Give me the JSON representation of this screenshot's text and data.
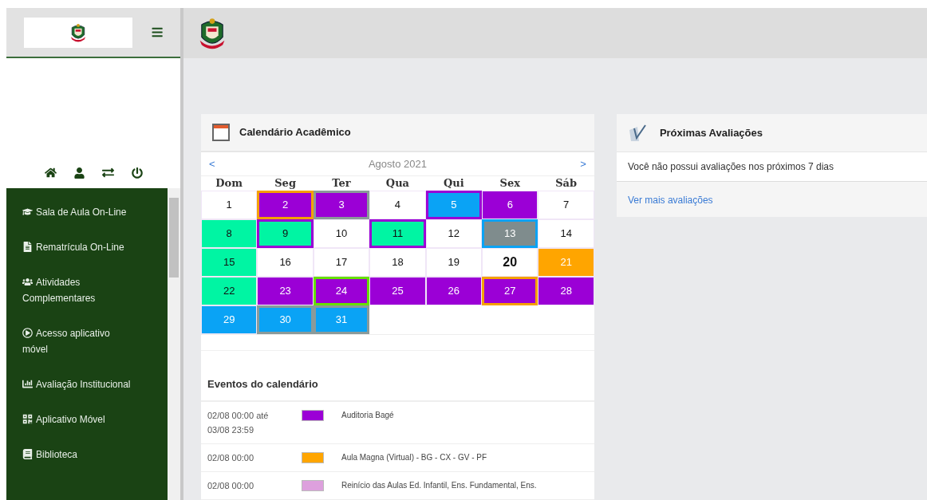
{
  "sidebar": {
    "menu": [
      {
        "label": "Sala de Aula On-Line"
      },
      {
        "label": "Rematrícula On-Line"
      },
      {
        "label": "Atividades Complementares"
      },
      {
        "label": "Acesso aplicativo móvel"
      },
      {
        "label": "Avaliação Institucional"
      },
      {
        "label": "Aplicativo Móvel"
      },
      {
        "label": "Biblioteca"
      }
    ]
  },
  "calendar": {
    "title": "Calendário Acadêmico",
    "prev": "<",
    "next": ">",
    "month": "Agosto 2021",
    "weekdays": [
      "Dom",
      "Seg",
      "Ter",
      "Qua",
      "Qui",
      "Sex",
      "Sáb"
    ],
    "days": [
      {
        "day": "1",
        "today": false
      },
      {
        "day": "2",
        "color": "#9b00d6",
        "ring": {
          "color": "#f5a000"
        },
        "today": false
      },
      {
        "day": "3",
        "color": "#9b00d6",
        "ring": {
          "color": "#8a9a9a"
        },
        "today": false
      },
      {
        "day": "4",
        "today": false
      },
      {
        "day": "5",
        "color": "#0aa3f5",
        "ring": {
          "color": "#9b00d6"
        },
        "today": false
      },
      {
        "day": "6",
        "color": "#9b00d6",
        "today": false
      },
      {
        "day": "7",
        "today": false
      },
      {
        "day": "8",
        "color": "#00f5a3",
        "today": false
      },
      {
        "day": "9",
        "color": "#00f5a3",
        "ring": {
          "color": "#9b00d6"
        },
        "today": false
      },
      {
        "day": "10",
        "today": false
      },
      {
        "day": "11",
        "color": "#00f5a3",
        "ring": {
          "color": "#9b00d6"
        },
        "today": false
      },
      {
        "day": "12",
        "today": false
      },
      {
        "day": "13",
        "color": "#7f8c8d",
        "ring": {
          "color": "#0aa3f5"
        },
        "today": false
      },
      {
        "day": "14",
        "today": false
      },
      {
        "day": "15",
        "color": "#00f5a3",
        "today": false
      },
      {
        "day": "16",
        "today": false
      },
      {
        "day": "17",
        "today": false
      },
      {
        "day": "18",
        "today": false
      },
      {
        "day": "19",
        "today": false
      },
      {
        "day": "20",
        "today": true
      },
      {
        "day": "21",
        "color": "#ffa500",
        "today": false
      },
      {
        "day": "22",
        "color": "#00f5a3",
        "today": false
      },
      {
        "day": "23",
        "color": "#9b00d6",
        "today": false
      },
      {
        "day": "24",
        "color": "#9b00d6",
        "ring": {
          "color": "#66e000"
        },
        "today": false
      },
      {
        "day": "25",
        "color": "#9b00d6",
        "today": false
      },
      {
        "day": "26",
        "color": "#9b00d6",
        "today": false
      },
      {
        "day": "27",
        "color": "#9b00d6",
        "ring": {
          "color": "#f5a000"
        },
        "today": false
      },
      {
        "day": "28",
        "color": "#9b00d6",
        "today": false
      },
      {
        "day": "29",
        "color": "#0aa3f5",
        "today": false
      },
      {
        "day": "30",
        "color": "#0aa3f5",
        "ring": {
          "color": "#8a9a9a"
        },
        "today": false
      },
      {
        "day": "31",
        "color": "#0aa3f5",
        "ring": {
          "color": "#8a9a9a"
        },
        "today": false
      }
    ],
    "events_title": "Eventos do calendário",
    "events": [
      {
        "date": "02/08 00:00 até 03/08 23:59",
        "color": "#9b00d6",
        "name": "Auditoria Bagé"
      },
      {
        "date": "02/08 00:00",
        "color": "#ffa500",
        "name": "Aula Magna (Virtual) - BG - CX - GV - PF"
      },
      {
        "date": "02/08 00:00",
        "color": "#dda0dd",
        "name": "Reinício das Aulas Ed. Infantil, Ens. Fundamental, Ens."
      }
    ]
  },
  "evaluations": {
    "title": "Próximas Avaliações",
    "message": "Você não possui avaliações nos próximos 7 dias",
    "link": "Ver mais avaliações"
  }
}
